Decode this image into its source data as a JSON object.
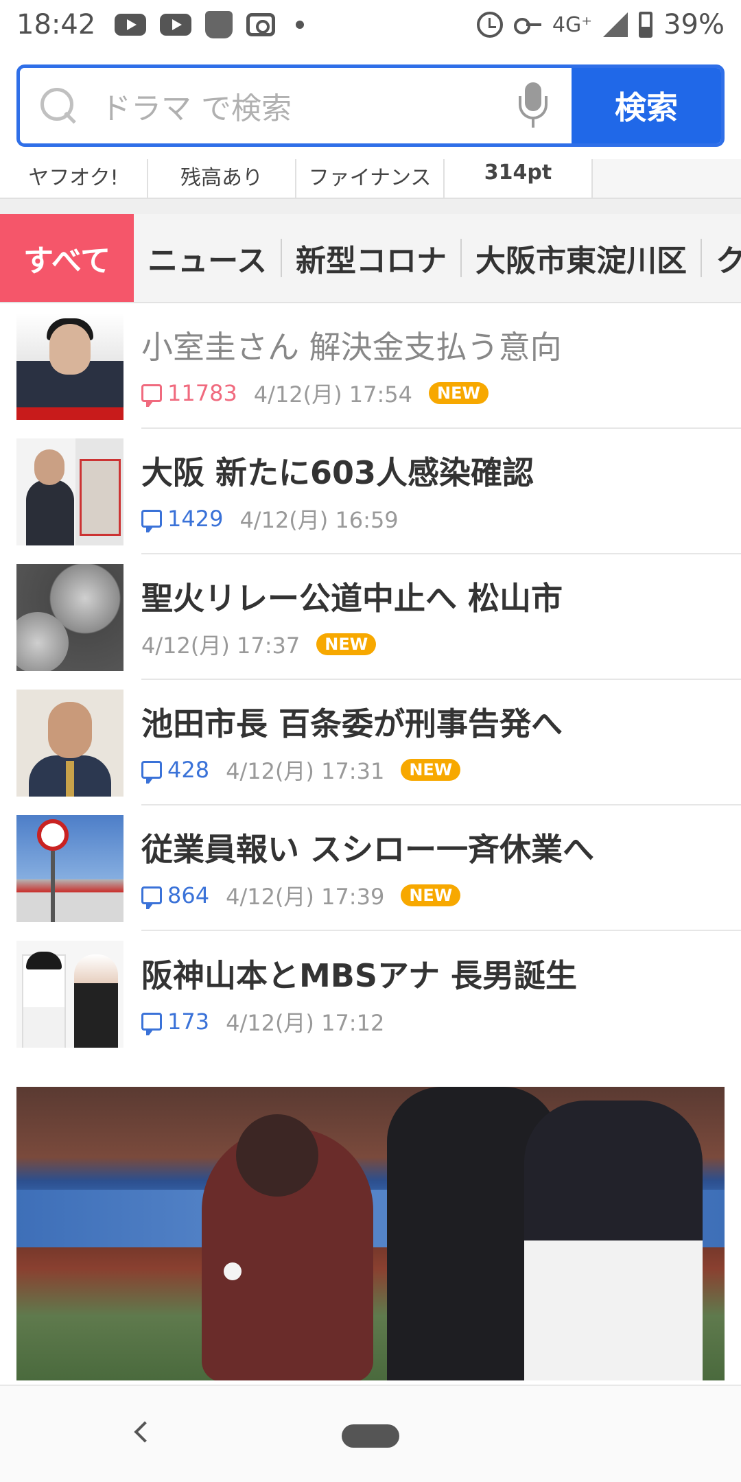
{
  "status_bar": {
    "time": "18:42",
    "network": "4G⁺",
    "battery": "39%"
  },
  "search": {
    "placeholder": "ドラマ で検索",
    "button_label": "検索"
  },
  "quick_links": [
    {
      "label": "ヤフオク!"
    },
    {
      "label": "残高あり"
    },
    {
      "label": "ファイナンス"
    },
    {
      "label": "314pt"
    }
  ],
  "tabs": [
    {
      "label": "すべて",
      "active": true
    },
    {
      "label": "ニュース"
    },
    {
      "label": "新型コロナ"
    },
    {
      "label": "大阪市東淀川区"
    },
    {
      "label": "クー"
    }
  ],
  "news": [
    {
      "title": "小室圭さん 解決金支払う意向",
      "comments": "11783",
      "time": "4/12(月) 17:54",
      "badge": "NEW",
      "read": true
    },
    {
      "title": "大阪 新たに603人感染確認",
      "comments": "1429",
      "time": "4/12(月) 16:59"
    },
    {
      "title": "聖火リレー公道中止へ 松山市",
      "time": "4/12(月) 17:37",
      "badge": "NEW"
    },
    {
      "title": "池田市長 百条委が刑事告発へ",
      "comments": "428",
      "time": "4/12(月) 17:31",
      "badge": "NEW"
    },
    {
      "title": "従業員報い スシロー一斉休業へ",
      "comments": "864",
      "time": "4/12(月) 17:39",
      "badge": "NEW"
    },
    {
      "title": "阪神山本とMBSアナ 長男誕生",
      "comments": "173",
      "time": "4/12(月) 17:12"
    }
  ]
}
